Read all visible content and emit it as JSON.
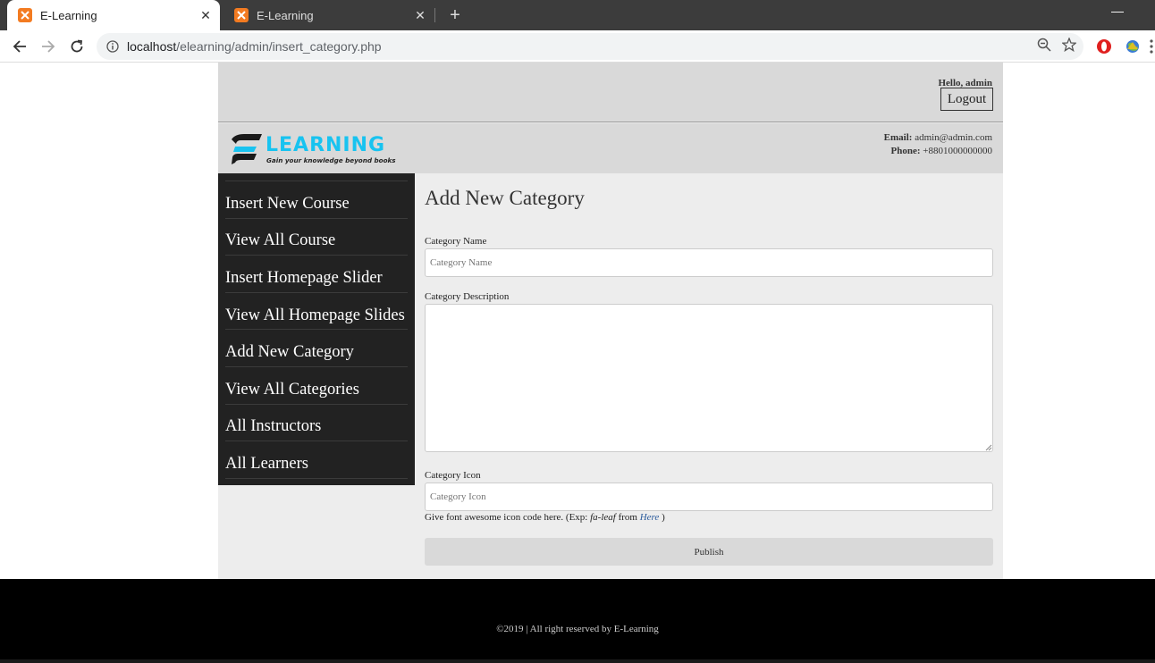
{
  "browser": {
    "tabs": [
      {
        "title": "E-Learning",
        "active": true
      },
      {
        "title": "E-Learning",
        "active": false
      }
    ],
    "url_host": "localhost",
    "url_path": "/elearning/admin/insert_category.php",
    "new_tab_symbol": "+",
    "minimize_symbol": "—",
    "close_symbol": "✕"
  },
  "header": {
    "greeting": "Hello, admin",
    "logout_label": "Logout",
    "logo_text": "ELEARNING",
    "logo_tagline": "Gain your knowledge beyond books",
    "email_label": "Email:",
    "email_value": "admin@admin.com",
    "phone_label": "Phone:",
    "phone_value": "+8801000000000",
    "brand_color": "#18c3f0"
  },
  "sidebar": {
    "items": [
      {
        "label": "Insert New Course"
      },
      {
        "label": "View All Course"
      },
      {
        "label": "Insert Homepage Slider"
      },
      {
        "label": "View All Homepage Slides"
      },
      {
        "label": "Add New Category"
      },
      {
        "label": "View All Categories"
      },
      {
        "label": "All Instructors"
      },
      {
        "label": "All Learners"
      }
    ]
  },
  "form": {
    "title": "Add New Category",
    "name_label": "Category Name",
    "name_placeholder": "Category Name",
    "description_label": "Category Description",
    "description_value": "",
    "icon_label": "Category Icon",
    "icon_placeholder": "Category Icon",
    "hint_prefix": "Give font awesome icon code here. (Exp: ",
    "hint_example": "fa-leaf",
    "hint_middle": " from ",
    "hint_link": "Here",
    "hint_suffix": " )",
    "publish_label": "Publish"
  },
  "footer": {
    "text": "©2019 | All right reserved by E-Learning"
  }
}
